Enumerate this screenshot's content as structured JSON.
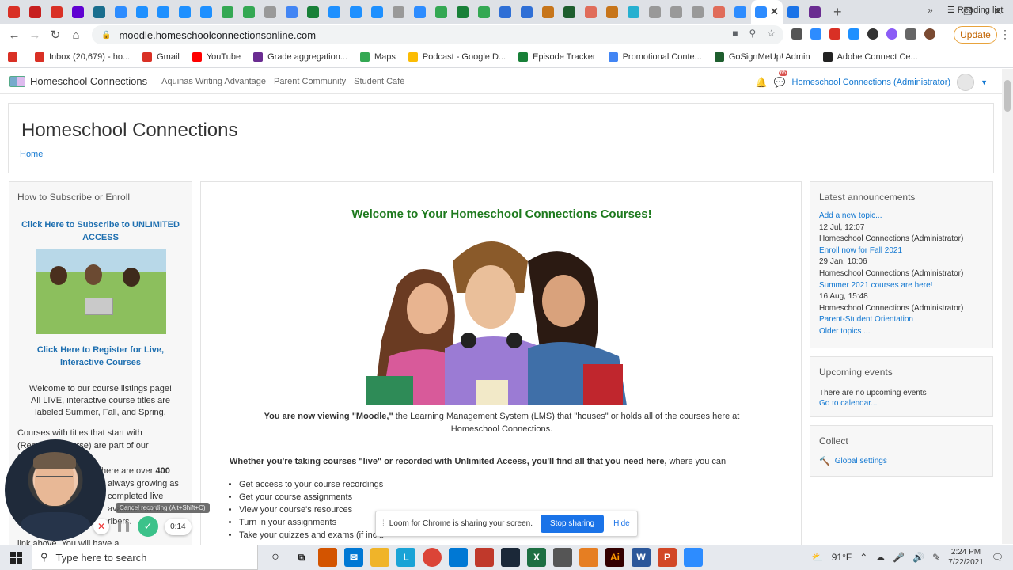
{
  "browser": {
    "tab_colors": [
      "#d93025",
      "#c71f1f",
      "#d93025",
      "#6001d2",
      "#1a6e8e",
      "#2d8cff",
      "#1e90ff",
      "#1e90ff",
      "#1e90ff",
      "#1e90ff",
      "#34a853",
      "#34a853",
      "#999",
      "#4285f4",
      "#188038",
      "#1e90ff",
      "#1e90ff",
      "#1e90ff",
      "#999",
      "#2d8cff",
      "#34a853",
      "#188038",
      "#34a853",
      "#2f6fd6",
      "#2f6fd6",
      "#c7751a",
      "#1e5e2e",
      "#e06c5a",
      "#c7751a",
      "#26b0d0",
      "#999",
      "#999",
      "#999",
      "#e06c5a",
      "#2d8cff"
    ],
    "active_tab_color": "#2d8cff",
    "extra_tab_colors": [
      "#1a73e8",
      "#6a2c91"
    ],
    "url": "moodle.homeschoolconnectionsonline.com",
    "update_label": "Update"
  },
  "bookmarks": {
    "items": [
      {
        "label": "",
        "color": "#d93025"
      },
      {
        "label": "Inbox (20,679) - ho...",
        "color": "#d93025"
      },
      {
        "label": "Gmail",
        "color": "#d93025"
      },
      {
        "label": "YouTube",
        "color": "#ff0000"
      },
      {
        "label": "Grade aggregation...",
        "color": "#6a2c91"
      },
      {
        "label": "Maps",
        "color": "#34a853"
      },
      {
        "label": "Podcast - Google D...",
        "color": "#fbbc04"
      },
      {
        "label": "Episode Tracker",
        "color": "#188038"
      },
      {
        "label": "Promotional Conte...",
        "color": "#4285f4"
      },
      {
        "label": "GoSignMeUp! Admin",
        "color": "#1e5e2e"
      },
      {
        "label": "Adobe Connect Ce...",
        "color": "#222"
      }
    ],
    "more": "»",
    "reading_list": "Reading list"
  },
  "moodle_nav": {
    "brand": "Homeschool Connections",
    "links": [
      "Aquinas Writing Advantage",
      "Parent Community",
      "Student Café"
    ],
    "message_count": "65",
    "user": "Homeschool Connections (Administrator)"
  },
  "page_header": {
    "title": "Homeschool Connections",
    "breadcrumb": "Home"
  },
  "left_block": {
    "title": "How to Subscribe or Enroll",
    "subscribe_link": "Click Here to Subscribe to UNLIMITED ACCESS",
    "register_link": "Click Here to Register for Live, Interactive Courses",
    "welcome_line1": "Welcome to our course listings page!",
    "welcome_line2": "All LIVE, interactive course titles are labeled Summer, Fall, and Spring.",
    "courses_text_1": "Courses with titles that start with (Recorded Course) are part of our Unlimited Access",
    "courses_text_2": "here are over",
    "courses_count": "400",
    "courses_text_3": "always growing as",
    "courses_text_4": "completed live",
    "courses_text_5": "available to our",
    "courses_text_6": "ribers.",
    "courses_text_7": "link above. You will have a"
  },
  "main": {
    "heading": "Welcome to Your Homeschool Connections Courses!",
    "viewing_bold": "You are now viewing \"Moodle,\"",
    "viewing_rest": " the Learning Management System (LMS) that \"houses\" or holds all of the courses here at Homeschool Connections.",
    "whether_bold": "Whether you're taking courses \"live\" or recorded with Unlimited Access, you'll find all that you need here,",
    "whether_rest": " where you can",
    "bullets": [
      "Get access to your course recordings",
      "Get your course assignments",
      "View your course's resources",
      "Turn in your assignments",
      "Take your quizzes and exams (if inclu"
    ]
  },
  "announcements": {
    "title": "Latest announcements",
    "add_topic": "Add a new topic...",
    "items": [
      {
        "date": "12 Jul, 12:07",
        "author": "Homeschool Connections (Administrator)",
        "title": "Enroll now for Fall 2021"
      },
      {
        "date": "29 Jan, 10:06",
        "author": "Homeschool Connections (Administrator)",
        "title": "Summer 2021 courses are here!"
      },
      {
        "date": "16 Aug, 15:48",
        "author": "Homeschool Connections (Administrator)",
        "title": "Parent-Student Orientation"
      }
    ],
    "older": "Older topics ..."
  },
  "events": {
    "title": "Upcoming events",
    "none": "There are no upcoming events",
    "calendar": "Go to calendar..."
  },
  "collect": {
    "title": "Collect",
    "link": "Global settings"
  },
  "loom": {
    "message": "Loom for Chrome is sharing your screen.",
    "stop": "Stop sharing",
    "hide": "Hide",
    "tooltip": "Cancel recording (Alt+Shift+C)",
    "timer": "0:14"
  },
  "taskbar": {
    "search_placeholder": "Type here to search",
    "weather": "91°F",
    "time": "2:24 PM",
    "date": "7/22/2021"
  }
}
